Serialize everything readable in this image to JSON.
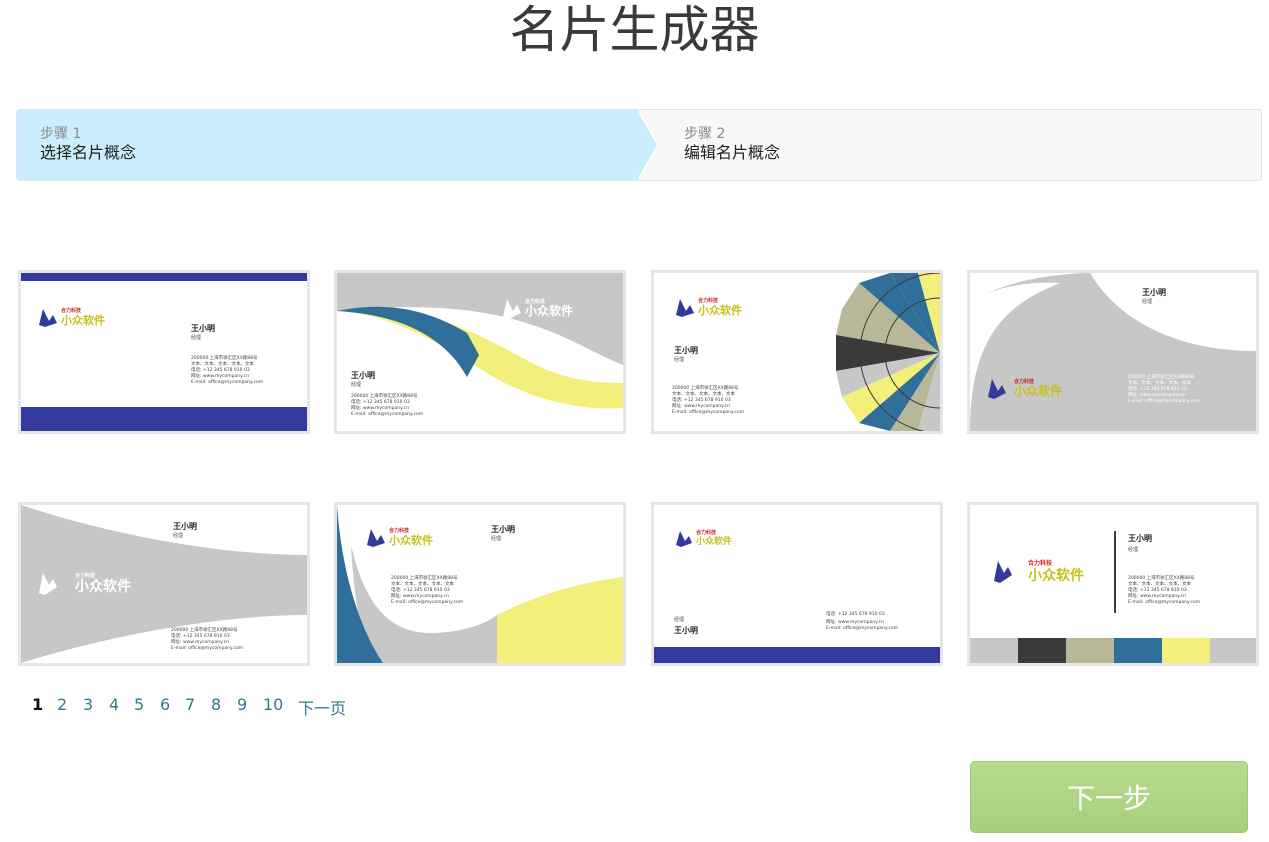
{
  "page": {
    "title": "名片生成器"
  },
  "wizard": {
    "steps": [
      {
        "num": "步骤 1",
        "label": "选择名片概念",
        "active": true
      },
      {
        "num": "步骤 2",
        "label": "编辑名片概念",
        "active": false
      }
    ]
  },
  "card": {
    "name": "王小明",
    "role": "经理",
    "brand_small": "合力科技",
    "brand_main": "小众软件",
    "address": "200000 上海市徐汇区XX路88号",
    "lorem": "文本、文本、文本、文本、文本",
    "phone_label": "电话:",
    "phone": "+12 345 678 910 03",
    "web_label": "网址:",
    "web": "www.mycompany.cn",
    "email_label": "E-mail:",
    "email": "office@mycompany.com"
  },
  "colors": {
    "navy": "#333a9e",
    "steel_blue": "#2f6f99",
    "yellow": "#f2f07a",
    "gray": "#c7c7c7",
    "dark": "#3a3a3a",
    "khaki": "#b8b899",
    "logo_red": "#cc2222",
    "logo_yellow": "#c8c01e"
  },
  "pagination": {
    "pages": [
      "1",
      "2",
      "3",
      "4",
      "5",
      "6",
      "7",
      "8",
      "9",
      "10"
    ],
    "current": "1",
    "next": "下一页"
  },
  "actions": {
    "next_button": "下一步"
  }
}
